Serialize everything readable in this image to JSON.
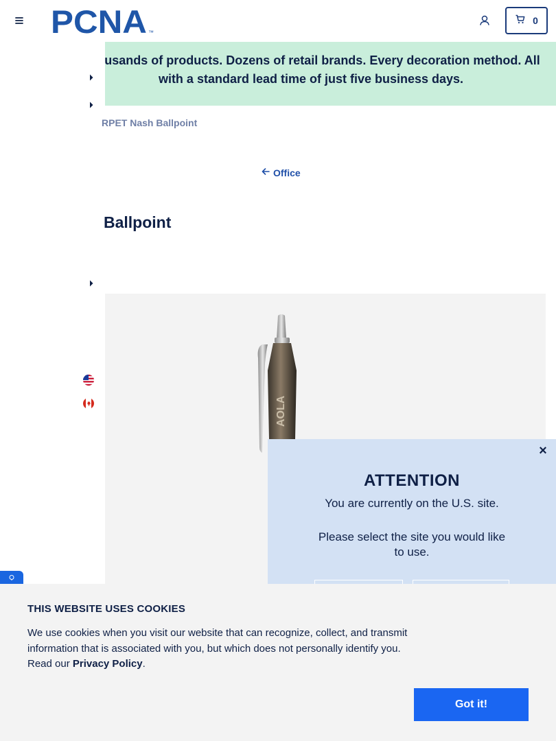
{
  "header": {
    "logo_text": "PCNA",
    "logo_mark": "™",
    "cart_count": "0"
  },
  "promo": {
    "text": "Thousands of products. Dozens of retail brands. Every decoration method. All with a standard lead time of just five business days."
  },
  "breadcrumb": {
    "current": "RPET Nash Ballpoint"
  },
  "back_link": {
    "label": "Office"
  },
  "product": {
    "title": "Ballpoint",
    "imprint_text": "AOLA"
  },
  "region_modal": {
    "heading": "ATTENTION",
    "line1": "You are currently on the U.S. site.",
    "line2": "Please select the site you would like to use.",
    "close_glyph": "×"
  },
  "cookie_banner": {
    "title": "THIS WEBSITE USES COOKIES",
    "text_before_link": "We use cookies when you visit our website that can recognize, collect, and transmit information that is associated with you, but which does not personally identify you. Read our ",
    "link_label": "Privacy Policy",
    "text_after_link": ".",
    "accept_label": "Got it!"
  },
  "icons": {
    "menu": "hamburger-menu-icon",
    "account": "user-icon",
    "cart": "shopping-cart-icon",
    "back": "arrow-left-icon",
    "flags": [
      "us-flag-icon",
      "canada-flag-icon"
    ]
  },
  "colors": {
    "brand_navy": "#1a3a7a",
    "promo_bg": "#c9eedb",
    "modal_bg": "#d3e1f4",
    "accept_button": "#1a66f2",
    "link_blue": "#1f4fa8"
  }
}
